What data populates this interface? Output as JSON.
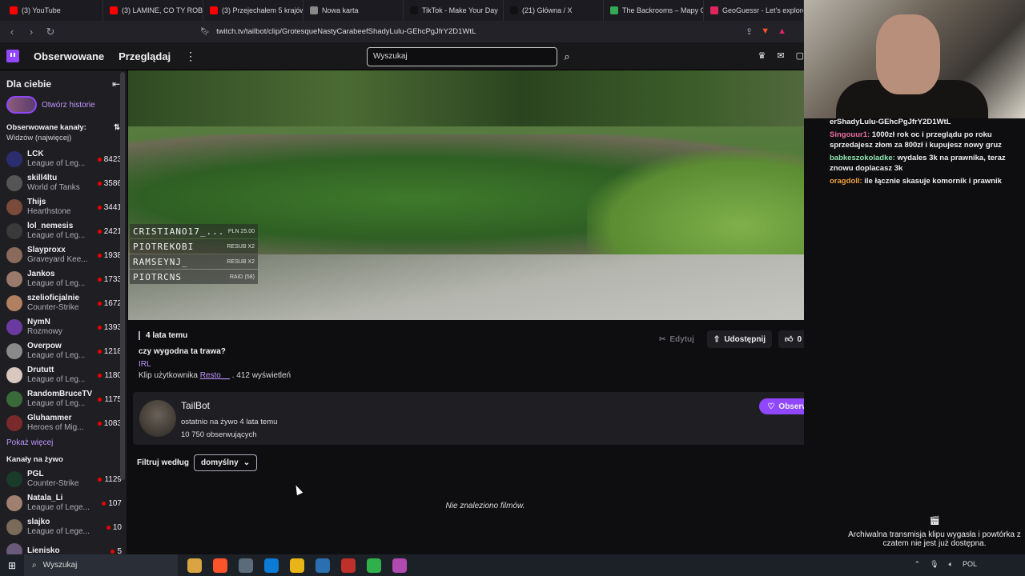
{
  "browser": {
    "tabs": [
      {
        "label": "(3) YouTube",
        "color": "#ff0000"
      },
      {
        "label": "(3) LAMINE, CO TY ROBISZ",
        "color": "#ff0000"
      },
      {
        "label": "(3) Przejechałem 5 krajów",
        "color": "#ff0000"
      },
      {
        "label": "Nowa karta",
        "color": "#888888"
      },
      {
        "label": "TikTok - Make Your Day",
        "color": "#111111"
      },
      {
        "label": "(21) Główna / X",
        "color": "#111111"
      },
      {
        "label": "The Backrooms – Mapy G",
        "color": "#34a853"
      },
      {
        "label": "GeoGuessr - Let's explore",
        "color": "#e0245e"
      }
    ],
    "url": "twitch.tv/tailbot/clip/GrotesqueNastyCarabeefShadyLulu-GEhcPgJfrY2D1WtL"
  },
  "topnav": {
    "following": "Obserwowane",
    "browse": "Przeglądaj",
    "search_placeholder": "Wyszukaj"
  },
  "sidebar": {
    "title": "Dla ciebie",
    "history": "Otwórz historie",
    "followed_title": "Obserwowane kanały:",
    "followed_sort": "Widzów (najwięcej)",
    "channels": [
      {
        "name": "LCK",
        "game": "League of Leg...",
        "viewers": "8423",
        "color": "#2b2d6e"
      },
      {
        "name": "skill4ltu",
        "game": "World of Tanks",
        "viewers": "3586",
        "color": "#555555"
      },
      {
        "name": "Thijs",
        "game": "Hearthstone",
        "viewers": "3441",
        "color": "#7a4a3a"
      },
      {
        "name": "lol_nemesis",
        "game": "League of Leg...",
        "viewers": "2421",
        "color": "#3a3a3a"
      },
      {
        "name": "Slayproxx",
        "game": "Graveyard Kee...",
        "viewers": "1938",
        "color": "#8a6a5a"
      },
      {
        "name": "Jankos",
        "game": "League of Leg...",
        "viewers": "1733",
        "color": "#9a7a6a"
      },
      {
        "name": "szelioficjalnie",
        "game": "Counter-Strike",
        "viewers": "1672",
        "color": "#b08060"
      },
      {
        "name": "NymN",
        "game": "Rozmowy",
        "viewers": "1393",
        "color": "#6b3aa0"
      },
      {
        "name": "Overpow",
        "game": "League of Leg...",
        "viewers": "1218",
        "color": "#8a8a8a"
      },
      {
        "name": "Drututt",
        "game": "League of Leg...",
        "viewers": "1180",
        "color": "#d8c8c0"
      },
      {
        "name": "RandomBruceTV",
        "game": "League of Leg...",
        "viewers": "1175",
        "color": "#3a6a3a"
      },
      {
        "name": "Gluhammer",
        "game": "Heroes of Mig...",
        "viewers": "1083",
        "color": "#7a2a2a"
      }
    ],
    "show_more": "Pokaż więcej",
    "live_title": "Kanały na żywo",
    "live": [
      {
        "name": "PGL",
        "game": "Counter-Strike",
        "viewers": "1129",
        "color": "#1a3a2a"
      },
      {
        "name": "Natala_Li",
        "game": "League of Lege...",
        "viewers": "107",
        "color": "#a08070"
      },
      {
        "name": "slajko",
        "game": "League of Lege...",
        "viewers": "10",
        "color": "#7a6a5a"
      },
      {
        "name": "Lienisko",
        "game": "",
        "viewers": "5",
        "color": "#6a5a7a"
      }
    ]
  },
  "video": {
    "overlay": [
      {
        "name": "CRISTIANO17_...",
        "tag": "PLN 25.00"
      },
      {
        "name": "PIOTREKOBI",
        "tag": "RESUB X2"
      },
      {
        "name": "RAMSEYNJ_",
        "tag": "RESUB X2"
      },
      {
        "name": "PIOTRCNS",
        "tag": "RAID (58)"
      }
    ]
  },
  "clip": {
    "age": "4 lata temu",
    "title": "czy wygodna ta trawa?",
    "category": "IRL",
    "by_prefix": "Klip użytkownika",
    "by_user": "Resto__",
    "views": ". 412 wyświetleń",
    "edit": "Edytuj",
    "share": "Udostępnij",
    "likes": "0"
  },
  "channel": {
    "name": "TailBot",
    "last_live": "ostatnio na żywo 4 lata temu",
    "followers": "10 750 obserwujących",
    "follow": "Obserwuj"
  },
  "filter": {
    "label": "Filtruj według",
    "value": "domyślny"
  },
  "empty_text": "Nie znaleziono filmów.",
  "chat": {
    "top_text": "erShadyLulu-GEhcPgJfrY2D1WtL",
    "messages": [
      {
        "user": "Singouur1:",
        "text": "1000zł rok oc i przeglądu po roku sprzedajesz złom za 800zł i kupujesz nowy gruz"
      },
      {
        "user": "babkeszokoladke:",
        "text": "wydales 3k na prawnika, teraz znowu doplacasz 3k"
      },
      {
        "user": "oragdoll:",
        "text": "ile łącznie skasuje komornik i prawnik"
      }
    ],
    "archive": "Archiwalna transmisja klipu wygasła i powtórka z czatem nie jest już dostępna."
  },
  "taskbar": {
    "search": "Wyszukaj",
    "lang": "POL",
    "apps": [
      "#d9a441",
      "#fb542b",
      "#5a6b7a",
      "#0b7bd6",
      "#e8b418",
      "#2a6fb0",
      "#c0302a",
      "#2fb04a",
      "#b04ab0"
    ]
  }
}
